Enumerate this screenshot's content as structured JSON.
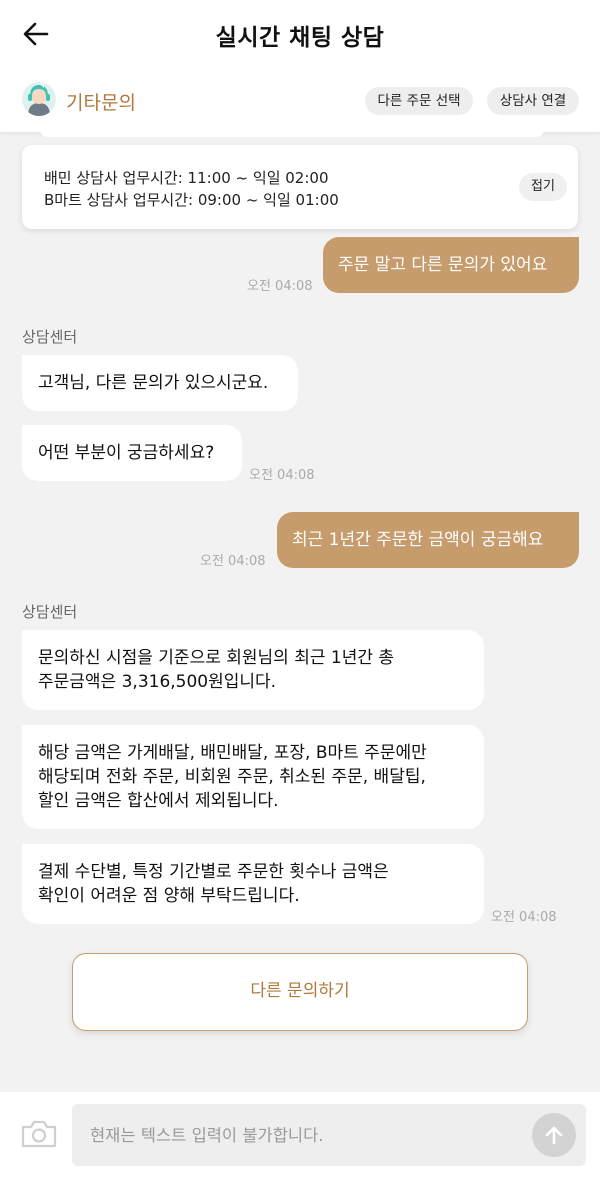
{
  "header": {
    "title": "실시간 채팅 상담"
  },
  "subheader": {
    "category": "기타문의",
    "select_order_label": "다른 주문 선택",
    "connect_agent_label": "상담사 연결"
  },
  "notice": {
    "line1": "배민 상담사 업무시간: 11:00 ~ 익일 02:00",
    "line2": "B마트 상담사 업무시간: 09:00 ~ 익일 01:00",
    "fold_label": "접기"
  },
  "messages": {
    "user1": {
      "text": "주문 말고 다른 문의가 있어요",
      "time": "오전 04:08"
    },
    "sender1": "상담센터",
    "bot1a": "고객님, 다른 문의가 있으시군요.",
    "bot1b": {
      "text": "어떤 부분이 궁금하세요?",
      "time": "오전 04:08"
    },
    "user2": {
      "text": "최근 1년간 주문한 금액이 궁금해요",
      "time": "오전 04:08"
    },
    "sender2": "상담센터",
    "bot2a": {
      "line1": "문의하신 시점을 기준으로 회원님의 최근 1년간 총",
      "line2": "주문금액은 3,316,500원입니다."
    },
    "bot2b": {
      "line1": "해당 금액은 가게배달, 배민배달, 포장, B마트 주문에만",
      "line2": "해당되며 전화 주문, 비회원 주문, 취소된 주문, 배달팁,",
      "line3": "할인 금액은 합산에서 제외됩니다."
    },
    "bot2c": {
      "line1": "결제 수단별, 특정 기간별로 주문한 횟수나 금액은",
      "line2": "확인이 어려운 점 양해 부탁드립니다.",
      "time": "오전 04:08"
    }
  },
  "action": {
    "other_inquiry_label": "다른 문의하기"
  },
  "input": {
    "placeholder": "현재는 텍스트 입력이 불가합니다."
  },
  "icons": {
    "back": "arrow-left-icon",
    "avatar": "agent-avatar-icon",
    "camera": "camera-icon",
    "send": "arrow-up-icon"
  },
  "colors": {
    "accent": "#c69c6c",
    "accent_text": "#b07a3c",
    "background": "#f2f2f2"
  }
}
